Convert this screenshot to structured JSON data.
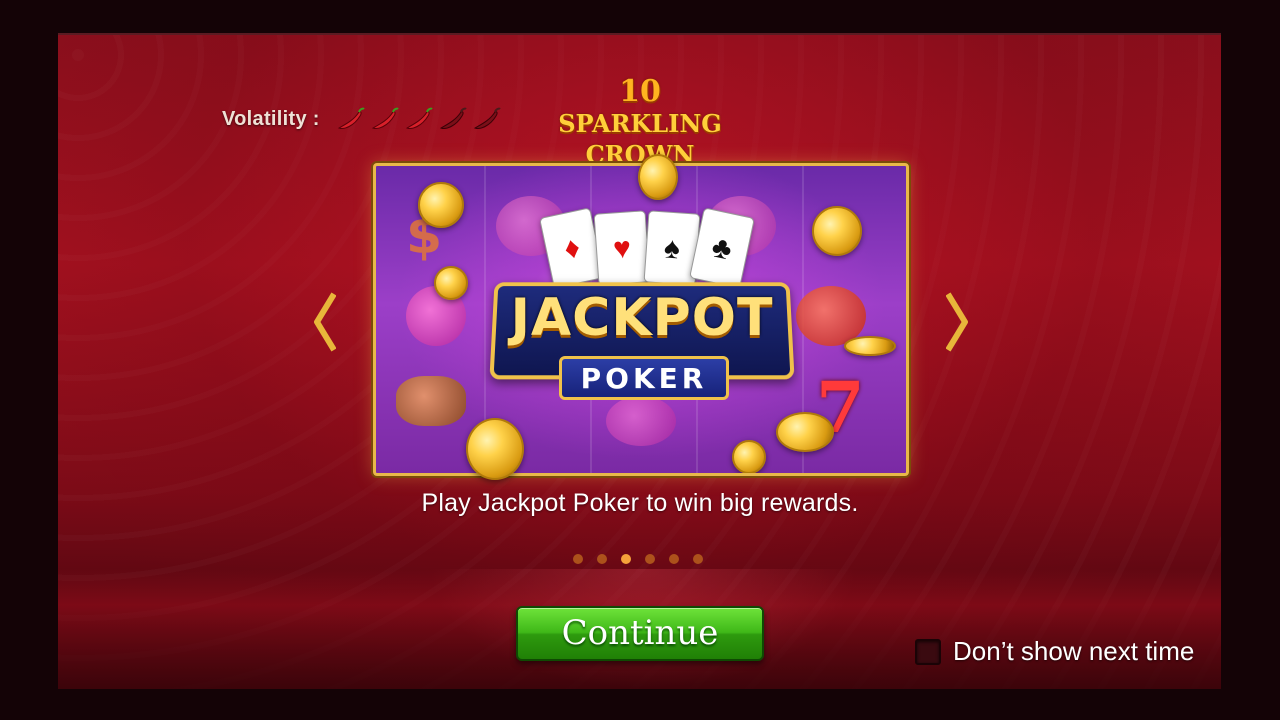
{
  "header": {
    "volatility_label": "Volatility :",
    "volatility": {
      "level": 3,
      "max": 5,
      "active_color": "#d8202a",
      "inactive_color": "#7a0f18",
      "icon": "chili-pepper-icon"
    },
    "game_title": {
      "number": "10",
      "word1": "SPARKLING",
      "word2": "CROWN"
    }
  },
  "banner": {
    "cards": [
      "♦",
      "♥",
      "♠",
      "♣"
    ],
    "logo_main": "JACKPOT",
    "logo_sub": "POKER"
  },
  "navigation": {
    "prev_icon": "chevron-left-icon",
    "next_icon": "chevron-right-icon"
  },
  "caption": "Play Jackpot Poker to win big rewards.",
  "pagination": {
    "count": 6,
    "active_index": 2
  },
  "actions": {
    "continue_label": "Continue",
    "dont_show_label": "Don’t show next time",
    "dont_show_checked": false
  },
  "colors": {
    "accent_gold": "#f0c24a",
    "button_green": "#3fb818",
    "background_red": "#a3111f"
  }
}
